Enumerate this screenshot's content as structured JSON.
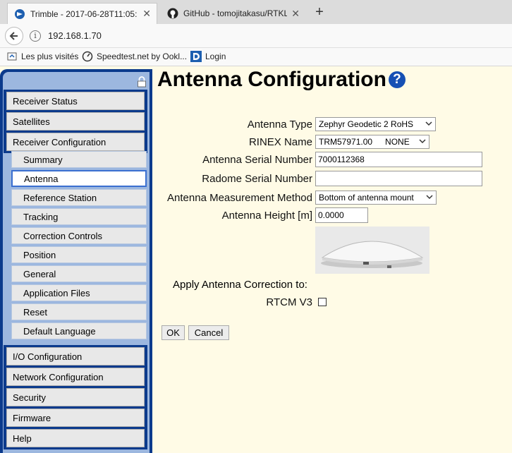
{
  "browser": {
    "tabs": [
      {
        "title": "Trimble - 2017-06-28T11:05:",
        "icon": "trimble-icon",
        "active": true
      },
      {
        "title": "GitHub - tomojitakasu/RTKL",
        "icon": "github-icon",
        "active": false
      }
    ],
    "url": "192.168.1.70",
    "bookmarks": [
      {
        "label": "Les plus visités",
        "icon": "bookmark-folder-icon"
      },
      {
        "label": "Speedtest.net by Ookl...",
        "icon": "speedtest-icon"
      },
      {
        "label": "Login",
        "icon": "d-logo-icon"
      }
    ]
  },
  "sidebar": {
    "top_items": [
      "Receiver Status",
      "Satellites",
      "Receiver Configuration"
    ],
    "sub_items": [
      "Summary",
      "Antenna",
      "Reference Station",
      "Tracking",
      "Correction Controls",
      "Position",
      "General",
      "Application Files",
      "Reset",
      "Default Language"
    ],
    "selected_sub": "Antenna",
    "bottom_items": [
      "I/O Configuration",
      "Network Configuration",
      "Security",
      "Firmware",
      "Help"
    ]
  },
  "main": {
    "title": "Antenna Configuration",
    "fields": {
      "antenna_type": {
        "label": "Antenna Type",
        "value": "Zephyr Geodetic 2 RoHS"
      },
      "rinex_name": {
        "label": "RINEX Name",
        "value": "TRM57971.00",
        "value2": "NONE"
      },
      "antenna_serial": {
        "label": "Antenna Serial Number",
        "value": "7000112368"
      },
      "radome_serial": {
        "label": "Radome Serial Number",
        "value": ""
      },
      "measurement_method": {
        "label": "Antenna Measurement Method",
        "value": "Bottom of antenna mount"
      },
      "antenna_height": {
        "label": "Antenna Height [m]",
        "value": "0.0000"
      }
    },
    "correction_section_label": "Apply Antenna Correction to:",
    "rtcm_label": "RTCM V3",
    "rtcm_checked": false,
    "ok_label": "OK",
    "cancel_label": "Cancel"
  },
  "colors": {
    "page_background": "#fffbe6",
    "sidebar_frame": "#0b3a8c",
    "sidebar_panel": "#9cb7df",
    "help_icon": "#1650b4"
  }
}
